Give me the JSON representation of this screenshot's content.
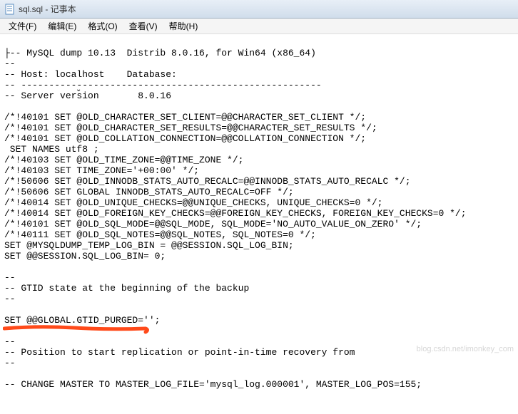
{
  "window": {
    "title": "sql.sql - 记事本"
  },
  "menu": {
    "file": "文件(F)",
    "edit": "编辑(E)",
    "format": "格式(O)",
    "view": "查看(V)",
    "help": "帮助(H)"
  },
  "content": {
    "lines": [
      "├-- MySQL dump 10.13  Distrib 8.0.16, for Win64 (x86_64)",
      "--",
      "-- Host: localhost    Database:",
      "-- ------------------------------------------------------",
      "-- Server version       8.0.16",
      "",
      "/*!40101 SET @OLD_CHARACTER_SET_CLIENT=@@CHARACTER_SET_CLIENT */;",
      "/*!40101 SET @OLD_CHARACTER_SET_RESULTS=@@CHARACTER_SET_RESULTS */;",
      "/*!40101 SET @OLD_COLLATION_CONNECTION=@@COLLATION_CONNECTION */;",
      " SET NAMES utf8 ;",
      "/*!40103 SET @OLD_TIME_ZONE=@@TIME_ZONE */;",
      "/*!40103 SET TIME_ZONE='+00:00' */;",
      "/*!50606 SET @OLD_INNODB_STATS_AUTO_RECALC=@@INNODB_STATS_AUTO_RECALC */;",
      "/*!50606 SET GLOBAL INNODB_STATS_AUTO_RECALC=OFF */;",
      "/*!40014 SET @OLD_UNIQUE_CHECKS=@@UNIQUE_CHECKS, UNIQUE_CHECKS=0 */;",
      "/*!40014 SET @OLD_FOREIGN_KEY_CHECKS=@@FOREIGN_KEY_CHECKS, FOREIGN_KEY_CHECKS=0 */;",
      "/*!40101 SET @OLD_SQL_MODE=@@SQL_MODE, SQL_MODE='NO_AUTO_VALUE_ON_ZERO' */;",
      "/*!40111 SET @OLD_SQL_NOTES=@@SQL_NOTES, SQL_NOTES=0 */;",
      "SET @MYSQLDUMP_TEMP_LOG_BIN = @@SESSION.SQL_LOG_BIN;",
      "SET @@SESSION.SQL_LOG_BIN= 0;",
      "",
      "--",
      "-- GTID state at the beginning of the backup",
      "--",
      "",
      "SET @@GLOBAL.GTID_PURGED='';",
      "",
      "--",
      "-- Position to start replication or point-in-time recovery from",
      "--",
      "",
      "-- CHANGE MASTER TO MASTER_LOG_FILE='mysql_log.000001', MASTER_LOG_POS=155;"
    ]
  },
  "watermark": "blog.csdn.net/imonkey_com"
}
